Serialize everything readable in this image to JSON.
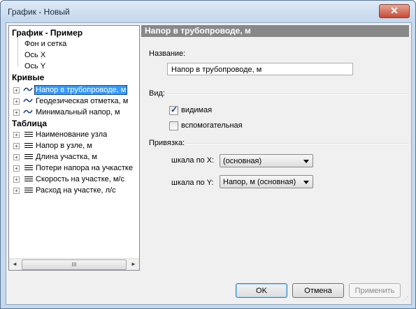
{
  "window": {
    "title": "График - Новый",
    "close_symbol": "✕"
  },
  "tree": {
    "graph_header": "График - Пример",
    "graph_children": [
      "Фон и сетка",
      "Ось X",
      "Ось Y"
    ],
    "curves_header": "Кривые",
    "curves": [
      "Напор в трубопроводе, м",
      "Геодезическая отметка, м",
      "Минимальный напор, м"
    ],
    "table_header": "Таблица",
    "table_items": [
      "Наименование узла",
      "Напор в узле, м",
      "Длина участка, м",
      "Потери напора на учкастке",
      "Скорость на участке, м/с",
      "Расход на участке, л/с"
    ],
    "selected_curve": "Напор в трубопроводе, м",
    "scroll_left": "◄",
    "scroll_right": "►",
    "scroll_grip": "III"
  },
  "panel": {
    "header": "Напор в трубопроводе, м",
    "name_label": "Название:",
    "name_value": "Напор в трубопроводе, м",
    "view_label": "Вид:",
    "visible_label": "видимая",
    "visible_checked": true,
    "auxiliary_label": "вспомогательная",
    "auxiliary_checked": false,
    "binding_label": "Привязка:",
    "scale_x_label": "шкала по X:",
    "scale_x_value": "(основная)",
    "scale_y_label": "шкала по Y:",
    "scale_y_value": "Напор, м (основная)"
  },
  "buttons": {
    "ok": "OK",
    "cancel": "Отмена",
    "apply": "Применить"
  },
  "icons": {
    "curve": "wave-icon",
    "column": "bars-icon",
    "expand": "plus-box-icon"
  },
  "colors": {
    "selection": "#3399ff",
    "header_bar": "#888888",
    "title_bg": "#c5d9ef",
    "close": "#c84b35"
  }
}
